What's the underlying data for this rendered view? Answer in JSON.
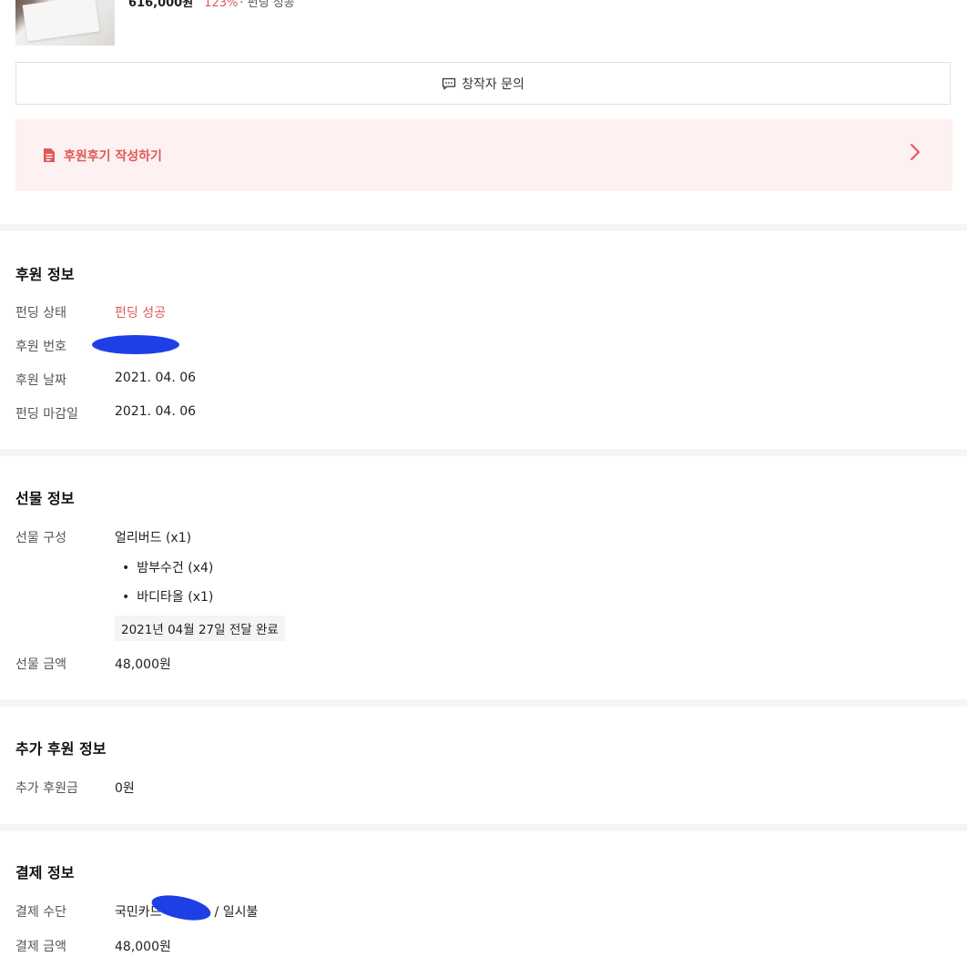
{
  "project": {
    "amount": "616,000원",
    "rate": "123%",
    "status": "· 펀딩 성공"
  },
  "inquiry_button": {
    "label": "창작자 문의",
    "icon": "message-icon"
  },
  "review_banner": {
    "label": "후원후기 작성하기",
    "icon": "document-icon",
    "chevron": "chevron-right-icon"
  },
  "sponsor_info": {
    "title": "후원 정보",
    "rows": [
      {
        "label": "펀딩 상태",
        "value": "펀딩 성공"
      },
      {
        "label": "후원 번호",
        "value": ""
      },
      {
        "label": "후원 날짜",
        "value": "2021. 04. 06"
      },
      {
        "label": "펀딩 마감일",
        "value": "2021. 04. 06"
      }
    ]
  },
  "gift_info": {
    "title": "선물 정보",
    "composition_label": "선물 구성",
    "composition_value": "얼리버드 (x1)",
    "items": [
      "밤부수건 (x4)",
      "바디타올 (x1)"
    ],
    "delivery_status": "2021년 04월 27일 전달 완료",
    "amount_label": "선물 금액",
    "amount_value": "48,000원"
  },
  "additional_info": {
    "title": "추가 후원 정보",
    "label": "추가 후원금",
    "value": "0원"
  },
  "payment_info": {
    "title": "결제 정보",
    "method_label": "결제 수단",
    "method_prefix": "국민카드",
    "method_suffix": "/ 일시불",
    "amount_label": "결제 금액",
    "amount_value": "48,000원"
  },
  "colors": {
    "accent": "#e05858",
    "banner_bg": "#fdf2f1",
    "redaction": "#1f3fe6"
  }
}
